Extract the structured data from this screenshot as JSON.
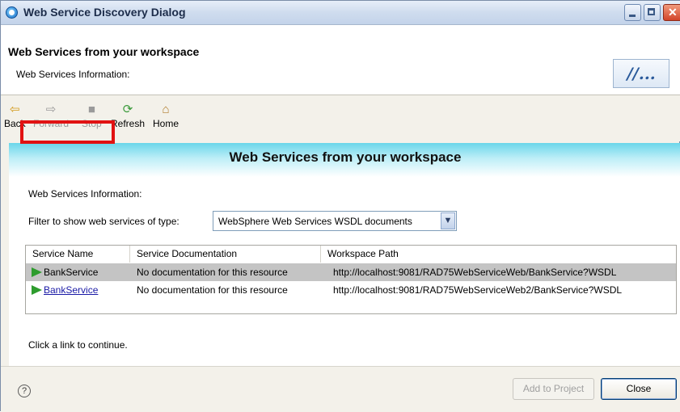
{
  "window": {
    "title": "Web Service Discovery Dialog",
    "minimize": "minimize",
    "maximize": "maximize",
    "close": "close"
  },
  "header": {
    "title": "Web Services from your workspace",
    "subtitle": "Web Services Information:",
    "logo_text": "//..."
  },
  "toolbar": {
    "back": "Back",
    "forward": "Forward",
    "stop": "Stop",
    "refresh": "Refresh",
    "home": "Home",
    "icons": {
      "back": "arrow-left-icon",
      "forward": "arrow-right-icon",
      "stop": "stop-icon",
      "refresh": "refresh-icon",
      "home": "home-icon"
    }
  },
  "content": {
    "banner_title": "Web Services from your workspace",
    "info_label": "Web Services Information:",
    "filter_label": "Filter to show web services of type:",
    "filter_value": "WebSphere Web Services WSDL documents",
    "continue_text": "Click a link to continue.",
    "banner_color": "#6ad6ea"
  },
  "table": {
    "columns": [
      "Service Name",
      "Service Documentation",
      "Workspace Path"
    ],
    "rows": [
      {
        "name": "BankService",
        "doc": "No documentation for this resource",
        "path": "http://localhost:9081/RAD75WebServiceWeb/BankService?WSDL",
        "selected": true
      },
      {
        "name": "BankService",
        "doc": "No documentation for this resource",
        "path": "http://localhost:9081/RAD75WebServiceWeb2/BankService?WSDL",
        "selected": false
      }
    ],
    "highlight_color": "#e11212"
  },
  "footer": {
    "help": "?",
    "add_to_project": "Add to Project",
    "close": "Close"
  }
}
